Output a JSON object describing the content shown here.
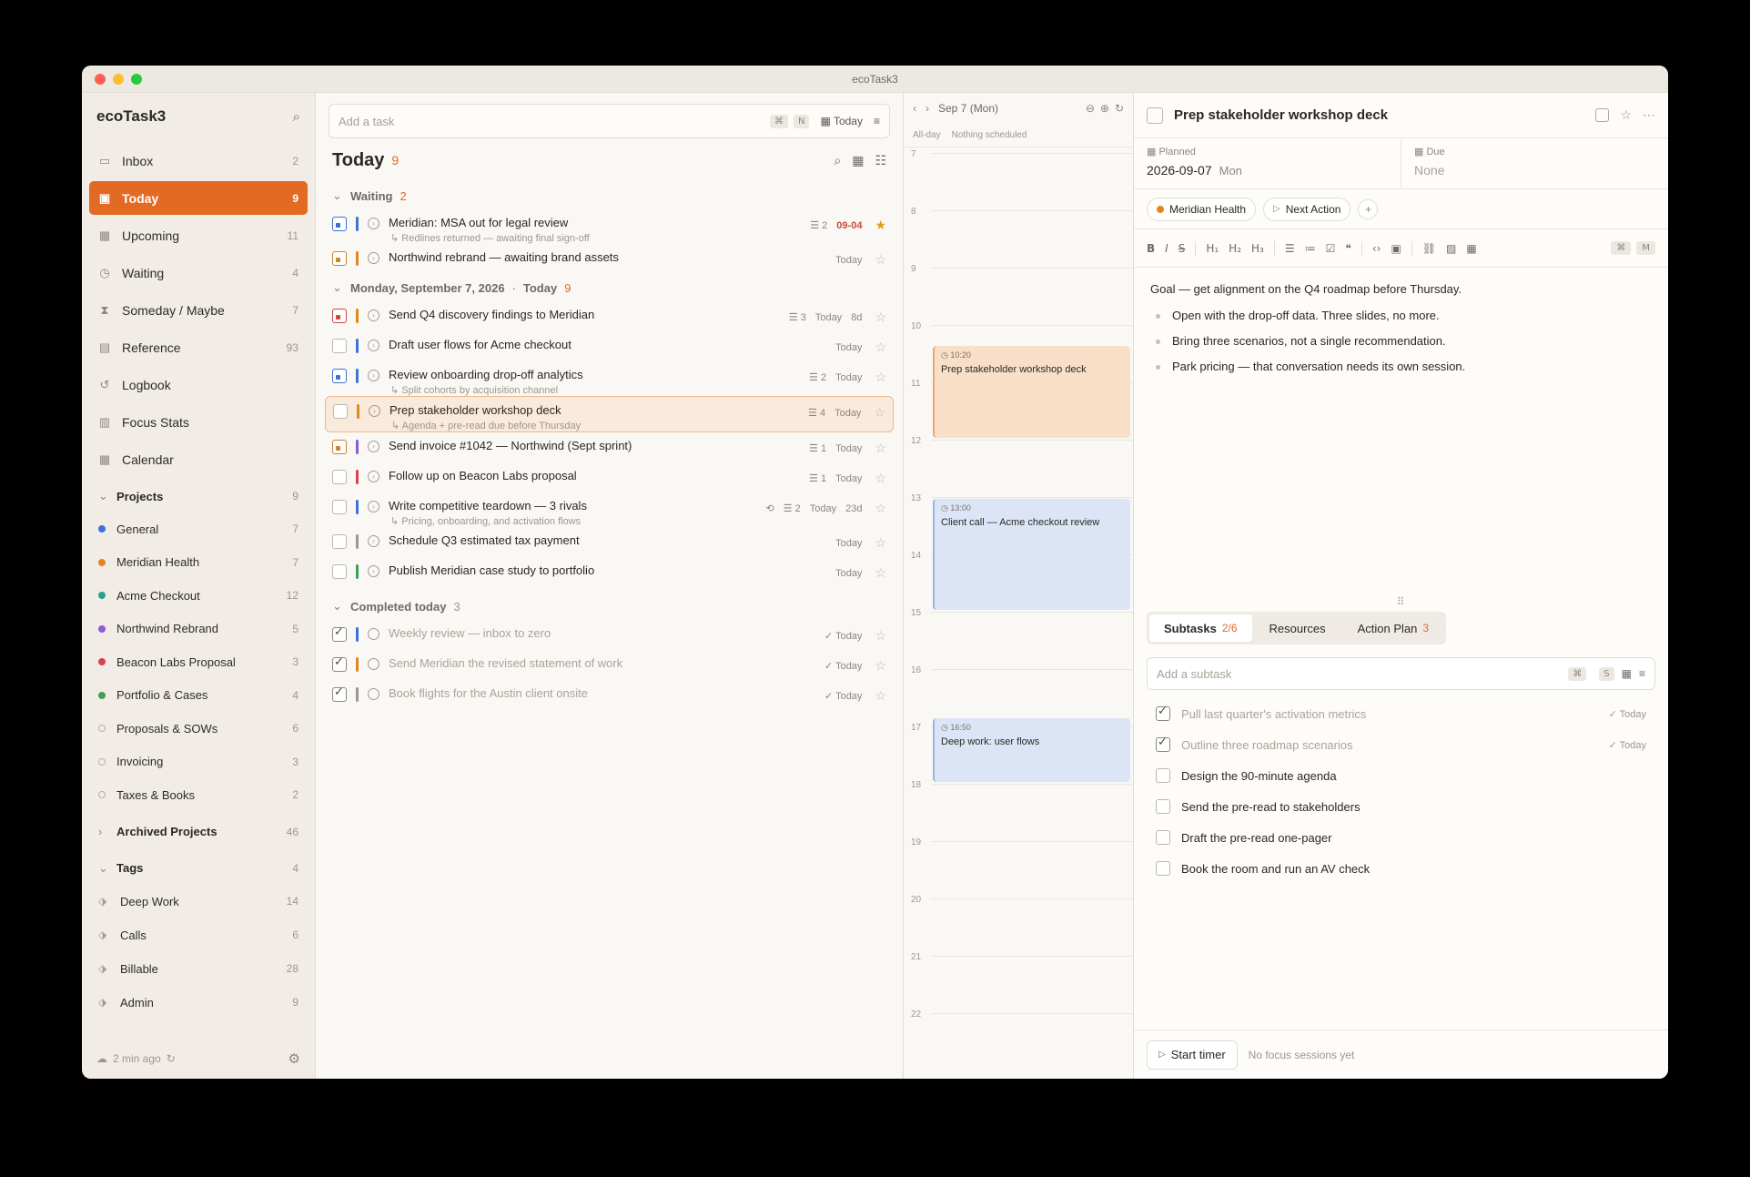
{
  "window": {
    "title": "ecoTask3"
  },
  "sidebar": {
    "app_name": "ecoTask3",
    "nav": [
      {
        "label": "Inbox",
        "count": "2",
        "icon": "inbox-icon",
        "glyph": "▭"
      },
      {
        "label": "Today",
        "count": "9",
        "icon": "calendar-today-icon",
        "glyph": "▣",
        "active": true
      },
      {
        "label": "Upcoming",
        "count": "11",
        "icon": "calendar-icon",
        "glyph": "▦"
      },
      {
        "label": "Waiting",
        "count": "4",
        "icon": "clock-icon",
        "glyph": "◷"
      },
      {
        "label": "Someday / Maybe",
        "count": "7",
        "icon": "hourglass-icon",
        "glyph": "⧗"
      },
      {
        "label": "Reference",
        "count": "93",
        "icon": "document-icon",
        "glyph": "▤"
      },
      {
        "label": "Logbook",
        "count": "",
        "icon": "history-icon",
        "glyph": "↺"
      },
      {
        "label": "Focus Stats",
        "count": "",
        "icon": "bar-chart-icon",
        "glyph": "▥"
      },
      {
        "label": "Calendar",
        "count": "",
        "icon": "calendar-grid-icon",
        "glyph": "▦"
      }
    ],
    "projects_label": "Projects",
    "projects_count": "9",
    "projects": [
      {
        "label": "General",
        "count": "7",
        "color": "#3f74d6"
      },
      {
        "label": "Meridian Health",
        "count": "7",
        "color": "#e3861e"
      },
      {
        "label": "Acme Checkout",
        "count": "12",
        "color": "#2f9e8f"
      },
      {
        "label": "Northwind Rebrand",
        "count": "5",
        "color": "#8e5bd6"
      },
      {
        "label": "Beacon Labs Proposal",
        "count": "3",
        "color": "#d9434f"
      },
      {
        "label": "Portfolio & Cases",
        "count": "4",
        "color": "#3f9e57"
      },
      {
        "label": "Proposals & SOWs",
        "count": "6",
        "color": ""
      },
      {
        "label": "Invoicing",
        "count": "3",
        "color": ""
      },
      {
        "label": "Taxes & Books",
        "count": "2",
        "color": ""
      }
    ],
    "archived_label": "Archived Projects",
    "archived_count": "46",
    "tags_label": "Tags",
    "tags_count": "4",
    "tags": [
      {
        "label": "Deep Work",
        "count": "14"
      },
      {
        "label": "Calls",
        "count": "6"
      },
      {
        "label": "Billable",
        "count": "28"
      },
      {
        "label": "Admin",
        "count": "9"
      }
    ],
    "sync_text": "2 min ago"
  },
  "tasklist": {
    "add_placeholder": "Add a task",
    "add_kbd1": "⌘",
    "add_kbd2": "N",
    "add_date": "Today",
    "title": "Today",
    "count": "9",
    "waiting_label": "Waiting",
    "waiting_count": "2",
    "waiting": [
      {
        "title": "Meridian: MSA out for legal review",
        "sub": "↳ Redlines returned — awaiting final sign-off",
        "prio": "blue",
        "bar": "#3f74d6",
        "sub_count": "2",
        "due": "09-04",
        "star": true
      },
      {
        "title": "Northwind rebrand — awaiting brand assets",
        "prio": "orange",
        "bar": "#e3861e",
        "date": "Today"
      }
    ],
    "day_label": "Monday, September 7, 2026",
    "day_today": "Today",
    "day_count": "9",
    "today": [
      {
        "title": "Send Q4 discovery findings to Meridian",
        "prio": "red",
        "bar": "#e3861e",
        "sub_count": "3",
        "date": "Today",
        "age": "8d"
      },
      {
        "title": "Draft user flows for Acme checkout",
        "prio": "",
        "bar": "#3f74d6",
        "date": "Today"
      },
      {
        "title": "Review onboarding drop-off analytics",
        "sub": "↳ Split cohorts by acquisition channel",
        "prio": "blue",
        "bar": "#3f74d6",
        "sub_count": "2",
        "date": "Today"
      },
      {
        "title": "Prep stakeholder workshop deck",
        "sub": "↳ Agenda + pre-read due before Thursday",
        "prio": "",
        "bar": "#e3861e",
        "sub_count": "4",
        "date": "Today",
        "selected": true
      },
      {
        "title": "Send invoice #1042 — Northwind (Sept sprint)",
        "prio": "orange",
        "bar": "#8e5bd6",
        "sub_count": "1",
        "date": "Today"
      },
      {
        "title": "Follow up on Beacon Labs proposal",
        "prio": "",
        "bar": "#d9434f",
        "sub_count": "1",
        "date": "Today"
      },
      {
        "title": "Write competitive teardown — 3 rivals",
        "sub": "↳ Pricing, onboarding, and activation flows",
        "prio": "",
        "bar": "#3f74d6",
        "repeat": true,
        "sub_count": "2",
        "date": "Today",
        "age": "23d"
      },
      {
        "title": "Schedule Q3 estimated tax payment",
        "prio": "",
        "bar": "#9d968c",
        "date": "Today"
      },
      {
        "title": "Publish Meridian case study to portfolio",
        "prio": "",
        "bar": "#3f9e57",
        "date": "Today"
      }
    ],
    "completed_label": "Completed today",
    "completed_count": "3",
    "completed": [
      {
        "title": "Weekly review — inbox to zero",
        "bar": "#3f74d6",
        "date": "✓ Today"
      },
      {
        "title": "Send Meridian the revised statement of work",
        "bar": "#e3861e",
        "date": "✓ Today"
      },
      {
        "title": "Book flights for the Austin client onsite",
        "bar": "#9d968c",
        "date": "✓ Today"
      }
    ]
  },
  "calendar": {
    "date_label": "Sep 7 (Mon)",
    "allday_label": "All-day",
    "allday_text": "Nothing scheduled",
    "hours": [
      "7",
      "8",
      "9",
      "10",
      "11",
      "12",
      "13",
      "14",
      "15",
      "16",
      "17",
      "18",
      "19",
      "20",
      "21",
      "22"
    ],
    "events": [
      {
        "time": "10:20",
        "title": "Prep stakeholder workshop deck",
        "color": "orange",
        "start_h": 10.33,
        "end_h": 12.0
      },
      {
        "time": "13:00",
        "title": "Client call — Acme checkout review",
        "color": "blue",
        "start_h": 13.0,
        "end_h": 15.0
      },
      {
        "time": "16:50",
        "title": "Deep work: user flows",
        "color": "blue",
        "start_h": 16.83,
        "end_h": 18.0
      }
    ]
  },
  "detail": {
    "title": "Prep stakeholder workshop deck",
    "planned_label": "Planned",
    "planned_value": "2026-09-07",
    "planned_dow": "Mon",
    "due_label": "Due",
    "due_value": "None",
    "project_chip": "Meridian Health",
    "status_chip": "Next Action",
    "toolbar_kbd1": "⌘",
    "toolbar_kbd2": "M",
    "goal": "Goal — get alignment on the Q4 roadmap before Thursday.",
    "bullets": [
      "Open with the drop-off data. Three slides, no more.",
      "Bring three scenarios, not a single recommendation.",
      "Park pricing — that conversation needs its own session."
    ],
    "tabs": [
      {
        "label": "Subtasks",
        "count": "2/6",
        "active": true
      },
      {
        "label": "Resources",
        "count": ""
      },
      {
        "label": "Action Plan",
        "count": "3"
      }
    ],
    "add_sub_placeholder": "Add a subtask",
    "add_sub_kbd1": "⌘",
    "add_sub_kbd2": "S",
    "subtasks": [
      {
        "label": "Pull last quarter's activation metrics",
        "done": true,
        "date": "✓ Today"
      },
      {
        "label": "Outline three roadmap scenarios",
        "done": true,
        "date": "✓ Today"
      },
      {
        "label": "Design the 90-minute agenda",
        "done": false
      },
      {
        "label": "Send the pre-read to stakeholders",
        "done": false
      },
      {
        "label": "Draft the pre-read one-pager",
        "done": false
      },
      {
        "label": "Book the room and run an AV check",
        "done": false
      }
    ],
    "start_timer": "Start timer",
    "focus_note": "No focus sessions yet"
  }
}
